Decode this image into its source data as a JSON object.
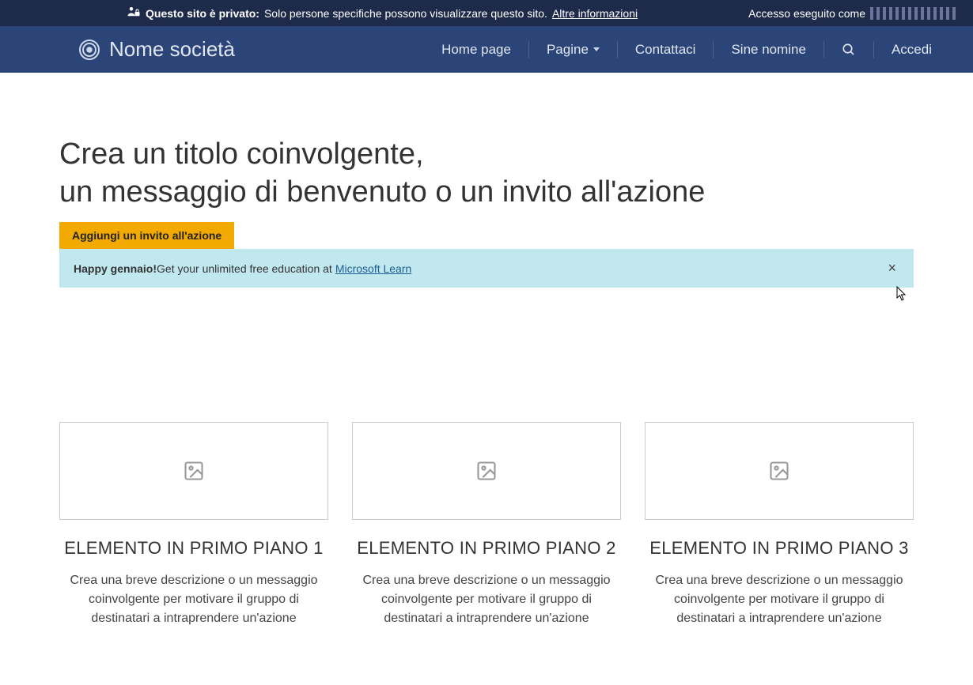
{
  "topbar": {
    "bold": "Questo sito è privato:",
    "text": "Solo persone specifiche possono visualizzare questo sito.",
    "link": "Altre informazioni",
    "right_prefix": "Accesso eseguito come"
  },
  "navbar": {
    "brand": "Nome società",
    "items": [
      "Home page",
      "Pagine",
      "Contattaci",
      "Sine nomine",
      "Accedi"
    ]
  },
  "hero": {
    "line1": "Crea un titolo coinvolgente,",
    "line2": "un messaggio di benvenuto o un invito all'azione",
    "cta": "Aggiungi un invito all'azione"
  },
  "banner": {
    "bold": "Happy gennaio!",
    "text": " Get your unlimited free education at ",
    "link": "Microsoft Learn"
  },
  "cards": [
    {
      "title": "ELEMENTO IN PRIMO PIANO 1",
      "desc": "Crea una breve descrizione o un messaggio coinvolgente per motivare il gruppo di destinatari a intraprendere un'azione"
    },
    {
      "title": "ELEMENTO IN PRIMO PIANO 2",
      "desc": "Crea una breve descrizione o un messaggio coinvolgente per motivare il gruppo di destinatari a intraprendere un'azione"
    },
    {
      "title": "ELEMENTO IN PRIMO PIANO 3",
      "desc": "Crea una breve descrizione o un messaggio coinvolgente per motivare il gruppo di destinatari a intraprendere un'azione"
    }
  ]
}
